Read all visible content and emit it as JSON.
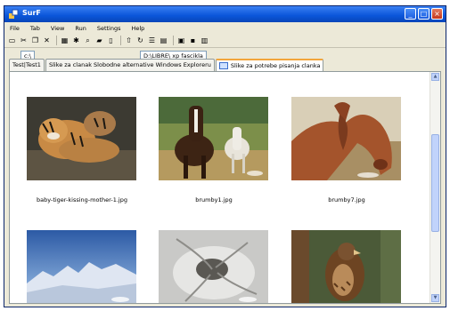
{
  "window": {
    "title": "SurF"
  },
  "menu": [
    "File",
    "Tab",
    "View",
    "Run",
    "Settings",
    "Help"
  ],
  "path": {
    "left": "c:\\",
    "right": "D:\\LIBRE\\ xp fascikla"
  },
  "tabs": [
    {
      "label": "Test|Test1",
      "active": false
    },
    {
      "label": "Slike za clanak Slobodne alternative Windows Exploreru",
      "active": false
    },
    {
      "label": "Slike za potrebe pisanja clanka",
      "active": true
    }
  ],
  "files": [
    {
      "name": "baby-tiger-kissing-mother-1.jpg"
    },
    {
      "name": "brumby1.jpg"
    },
    {
      "name": "brumby7.jpg"
    },
    {
      "name": ""
    },
    {
      "name": ""
    },
    {
      "name": ""
    }
  ],
  "colors": {
    "title_bar": "#0a55d9",
    "active_tab": "#f2a53b"
  }
}
